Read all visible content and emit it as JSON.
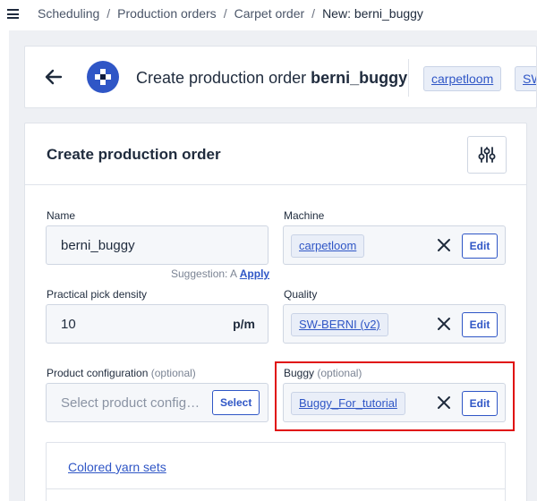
{
  "breadcrumb": {
    "items": [
      "Scheduling",
      "Production orders",
      "Carpet order"
    ],
    "current_prefix": "New: ",
    "current": "berni_buggy",
    "separator": "/"
  },
  "header": {
    "title_prefix": "Create production order ",
    "title_name": "berni_buggy",
    "chips": [
      "carpetloom",
      "SW"
    ]
  },
  "card": {
    "title": "Create production order"
  },
  "fields": {
    "name": {
      "label": "Name",
      "value": "berni_buggy",
      "suggestion": "Suggestion: A",
      "apply": "Apply"
    },
    "machine": {
      "label": "Machine",
      "value": "carpetloom",
      "edit": "Edit"
    },
    "pick_density": {
      "label": "Practical pick density",
      "value": "10",
      "unit": "p/m"
    },
    "quality": {
      "label": "Quality",
      "value": "SW-BERNI (v2)",
      "edit": "Edit"
    },
    "product_configuration": {
      "label": "Product configuration",
      "optional": "(optional)",
      "placeholder": "Select product config…",
      "select": "Select"
    },
    "buggy": {
      "label": "Buggy",
      "optional": "(optional)",
      "value": "Buggy_For_tutorial",
      "edit": "Edit"
    }
  },
  "yarn": {
    "link": "Colored yarn sets"
  },
  "colors": {
    "accent": "#2f56c6",
    "highlight": "#e01010",
    "page_bg": "#eef0f4"
  },
  "icons": [
    "menu-icon",
    "back-arrow-icon",
    "app-logo-icon",
    "sliders-icon",
    "close-icon"
  ]
}
